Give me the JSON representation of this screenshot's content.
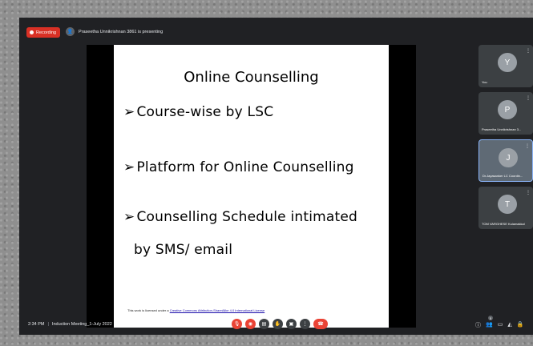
{
  "topbar": {
    "recording_label": "Recording",
    "presenting_text": "Praseetha Unnikrishnan 3861 is presenting"
  },
  "slide": {
    "title": "Online Counselling",
    "bullets": [
      "Course-wise by LSC",
      "Platform for Online Counselling",
      "Counselling Schedule intimated",
      "by SMS/ email"
    ],
    "arrow": "➢",
    "license_prefix": "This work is licensed under a",
    "license_link": "Creative Commons Attribution-ShareAlike 4.0 International License"
  },
  "participants": [
    {
      "name": "You",
      "initial": "Y"
    },
    {
      "name": "Praseetha Unnikrishnan 3...",
      "initial": "P"
    },
    {
      "name": "Dr.Jayasanker LC Coordin...",
      "initial": "J"
    },
    {
      "name": "TOM VARGHESE Kulamakkal",
      "initial": "T"
    }
  ],
  "bottombar": {
    "time": "2:34 PM",
    "meeting_name": "Induction Meeting_1-July 2022",
    "participant_count": "5"
  },
  "colors": {
    "meet_bg": "#202124",
    "tile_bg": "#3c4043",
    "red": "#ea4335",
    "active_border": "#8ab4f8"
  },
  "icons": {
    "mic": "mic-off-icon",
    "camera": "camera-off-icon",
    "captions": "captions-icon",
    "hand": "raise-hand-icon",
    "present": "present-screen-icon",
    "more": "more-options-icon",
    "end": "end-call-icon"
  }
}
